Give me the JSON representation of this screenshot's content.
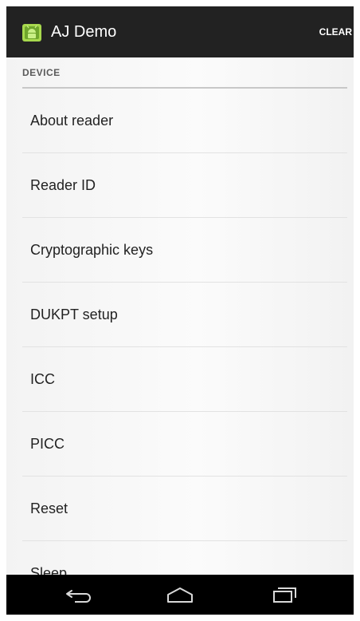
{
  "action_bar": {
    "title": "AJ Demo",
    "clear_label": "CLEAR"
  },
  "section": {
    "header": "DEVICE"
  },
  "items": [
    {
      "label": "About reader"
    },
    {
      "label": "Reader ID"
    },
    {
      "label": "Cryptographic keys"
    },
    {
      "label": "DUKPT setup"
    },
    {
      "label": "ICC"
    },
    {
      "label": "PICC"
    },
    {
      "label": "Reset"
    },
    {
      "label": "Sleep"
    }
  ],
  "nav_bar": {
    "icons": [
      "back-icon",
      "home-icon",
      "recent-apps-icon"
    ]
  },
  "colors": {
    "action_bar_bg": "#222222",
    "nav_bar_bg": "#000000",
    "app_icon_green": "#8cc63f"
  }
}
